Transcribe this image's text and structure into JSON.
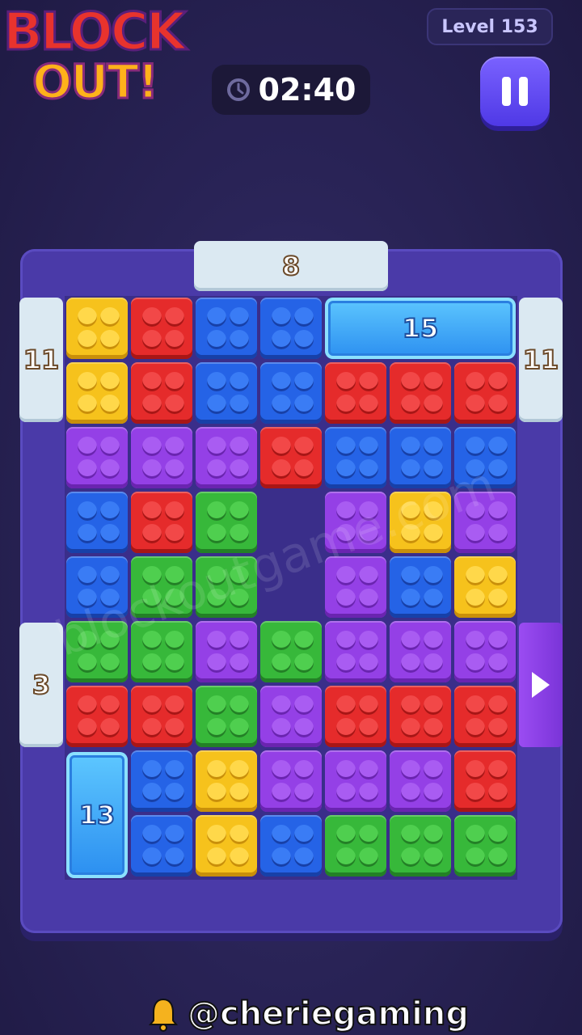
{
  "header": {
    "logo_line1": "BLOCK",
    "logo_line2": "OUT!",
    "level_label": "Level 153",
    "timer": "02:40",
    "timer_icon": "clock-icon",
    "pause_icon": "pause-icon"
  },
  "gates": {
    "top": "8",
    "left_top": "11",
    "right_top": "11",
    "left_middle": "3",
    "right_middle_icon": "arrow-right-icon"
  },
  "crystals": {
    "top_right": "15",
    "bottom_left": "13"
  },
  "colors": {
    "yellow": "#f6c21c",
    "red": "#e52b2b",
    "blue": "#2563e6",
    "purple": "#9440e6",
    "green": "#37b83a",
    "board": "#4a3aa8"
  },
  "grid": {
    "columns": 7,
    "rows": 9,
    "blocks": [
      {
        "color": "yellow",
        "cells": [
          [
            0,
            0
          ],
          [
            0,
            1
          ]
        ],
        "h": 2
      },
      {
        "color": "red",
        "cells": [
          [
            1,
            0
          ],
          [
            1,
            1
          ]
        ],
        "h": 2
      },
      {
        "color": "blue",
        "cells": [
          [
            2,
            0
          ],
          [
            3,
            0
          ],
          [
            2,
            1
          ],
          [
            3,
            1
          ]
        ],
        "h": 2
      },
      {
        "color": "red",
        "cells": [
          [
            4,
            1
          ],
          [
            5,
            1
          ],
          [
            6,
            1
          ]
        ]
      },
      {
        "color": "purple",
        "cells": [
          [
            0,
            2
          ],
          [
            1,
            2
          ],
          [
            2,
            2
          ]
        ]
      },
      {
        "color": "red",
        "cells": [
          [
            3,
            2
          ]
        ]
      },
      {
        "color": "blue",
        "cells": [
          [
            4,
            2
          ],
          [
            5,
            2
          ],
          [
            6,
            2
          ]
        ]
      },
      {
        "color": "blue",
        "cells": [
          [
            0,
            3
          ],
          [
            0,
            4
          ]
        ]
      },
      {
        "color": "red",
        "cells": [
          [
            1,
            3
          ]
        ]
      },
      {
        "color": "green",
        "cells": [
          [
            2,
            3
          ],
          [
            1,
            4
          ],
          [
            2,
            4
          ]
        ]
      },
      {
        "color": "purple",
        "cells": [
          [
            4,
            3
          ],
          [
            4,
            4
          ]
        ]
      },
      {
        "color": "yellow",
        "cells": [
          [
            5,
            3
          ]
        ]
      },
      {
        "color": "purple",
        "cells": [
          [
            6,
            3
          ]
        ]
      },
      {
        "color": "blue",
        "cells": [
          [
            5,
            4
          ]
        ]
      },
      {
        "color": "yellow",
        "cells": [
          [
            6,
            4
          ]
        ]
      },
      {
        "color": "green",
        "cells": [
          [
            0,
            5
          ],
          [
            1,
            5
          ]
        ]
      },
      {
        "color": "purple",
        "cells": [
          [
            2,
            5
          ]
        ]
      },
      {
        "color": "green",
        "cells": [
          [
            3,
            5
          ]
        ]
      },
      {
        "color": "purple",
        "cells": [
          [
            4,
            5
          ],
          [
            5,
            5
          ],
          [
            6,
            5
          ]
        ]
      },
      {
        "color": "red",
        "cells": [
          [
            0,
            6
          ],
          [
            1,
            6
          ]
        ]
      },
      {
        "color": "green",
        "cells": [
          [
            2,
            6
          ]
        ]
      },
      {
        "color": "purple",
        "cells": [
          [
            3,
            6
          ],
          [
            3,
            7
          ],
          [
            4,
            7
          ],
          [
            5,
            7
          ]
        ]
      },
      {
        "color": "red",
        "cells": [
          [
            4,
            6
          ],
          [
            5,
            6
          ],
          [
            6,
            6
          ],
          [
            6,
            7
          ]
        ]
      },
      {
        "color": "blue",
        "cells": [
          [
            1,
            7
          ],
          [
            1,
            8
          ]
        ]
      },
      {
        "color": "yellow",
        "cells": [
          [
            2,
            7
          ],
          [
            2,
            8
          ]
        ]
      },
      {
        "color": "blue",
        "cells": [
          [
            3,
            8
          ]
        ]
      },
      {
        "color": "green",
        "cells": [
          [
            4,
            8
          ],
          [
            5,
            8
          ],
          [
            6,
            8
          ]
        ]
      }
    ]
  },
  "watermark": "blockoutgame.com",
  "footer": {
    "handle": "@cheriegaming",
    "icon": "bell-icon"
  }
}
